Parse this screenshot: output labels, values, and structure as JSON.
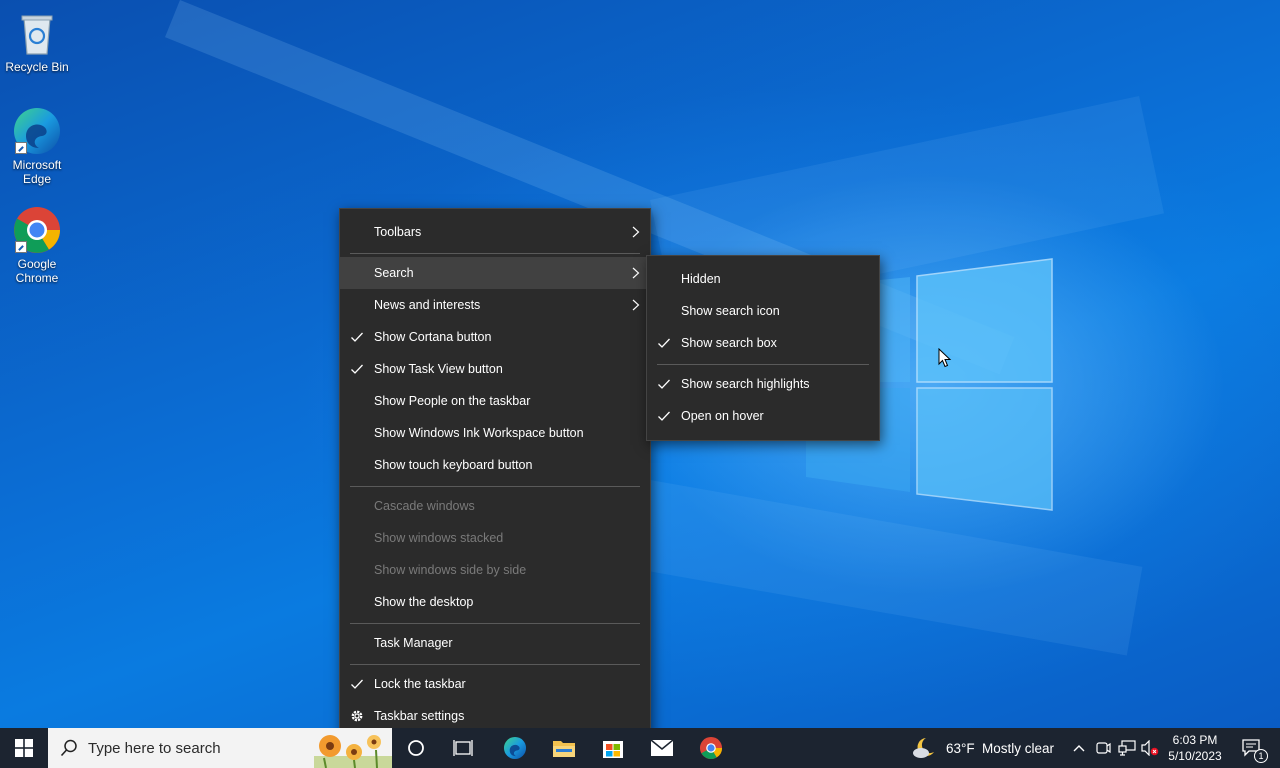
{
  "desktop": {
    "icons": [
      {
        "name": "recycle-bin",
        "label": "Recycle Bin"
      },
      {
        "name": "microsoft-edge",
        "label": "Microsoft Edge"
      },
      {
        "name": "google-chrome",
        "label": "Google Chrome"
      }
    ]
  },
  "context_menu": {
    "items": [
      {
        "label": "Toolbars",
        "checked": false,
        "submenu": true
      },
      {
        "label": "Search",
        "checked": false,
        "submenu": true,
        "highlighted": true
      },
      {
        "label": "News and interests",
        "checked": false,
        "submenu": true
      },
      {
        "label": "Show Cortana button",
        "checked": true
      },
      {
        "label": "Show Task View button",
        "checked": true
      },
      {
        "label": "Show People on the taskbar",
        "checked": false
      },
      {
        "label": "Show Windows Ink Workspace button",
        "checked": false
      },
      {
        "label": "Show touch keyboard button",
        "checked": false
      },
      {
        "label": "Cascade windows",
        "disabled": true
      },
      {
        "label": "Show windows stacked",
        "disabled": true
      },
      {
        "label": "Show windows side by side",
        "disabled": true
      },
      {
        "label": "Show the desktop",
        "checked": false
      },
      {
        "label": "Task Manager",
        "checked": false
      },
      {
        "label": "Lock the taskbar",
        "checked": true
      },
      {
        "label": "Taskbar settings",
        "icon": "gear-icon"
      }
    ]
  },
  "search_submenu": {
    "items": [
      {
        "label": "Hidden",
        "checked": false
      },
      {
        "label": "Show search icon",
        "checked": false
      },
      {
        "label": "Show search box",
        "checked": true
      },
      {
        "label": "Show search highlights",
        "checked": true
      },
      {
        "label": "Open on hover",
        "checked": true
      }
    ]
  },
  "taskbar": {
    "search_placeholder": "Type here to search",
    "weather": {
      "temp": "63°F",
      "condition": "Mostly clear"
    },
    "clock": {
      "time": "6:03 PM",
      "date": "5/10/2023"
    },
    "notification_count": "1"
  },
  "colors": {
    "menu_bg": "#2b2b2b",
    "menu_highlight": "#414141",
    "taskbar_bg": "#1c2430",
    "accent": "#0a6fd6"
  }
}
